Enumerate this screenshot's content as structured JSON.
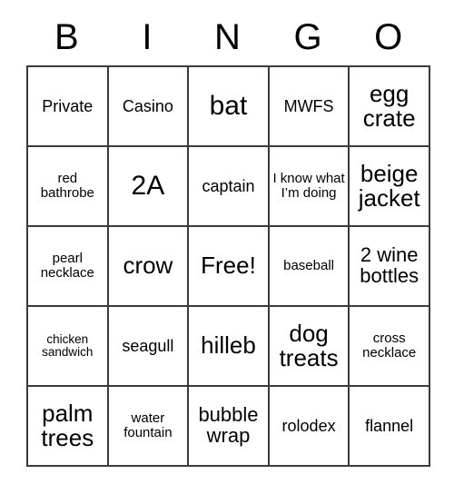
{
  "card": {
    "headers": [
      "B",
      "I",
      "N",
      "G",
      "O"
    ],
    "rows": [
      [
        {
          "text": "Private",
          "size": "fs-md"
        },
        {
          "text": "Casino",
          "size": "fs-md"
        },
        {
          "text": "bat",
          "size": "fs-xxl"
        },
        {
          "text": "MWFS",
          "size": "fs-md"
        },
        {
          "text": "egg crate",
          "size": "fs-xl"
        }
      ],
      [
        {
          "text": "red bathrobe",
          "size": "fs-sm"
        },
        {
          "text": "2A",
          "size": "fs-xxl"
        },
        {
          "text": "captain",
          "size": "fs-md"
        },
        {
          "text": "I know what I’m doing",
          "size": "fs-sm"
        },
        {
          "text": "beige jacket",
          "size": "fs-xl"
        }
      ],
      [
        {
          "text": "pearl necklace",
          "size": "fs-sm"
        },
        {
          "text": "crow",
          "size": "fs-xl"
        },
        {
          "text": "Free!",
          "size": "fs-xl"
        },
        {
          "text": "baseball",
          "size": "fs-sm"
        },
        {
          "text": "2 wine bottles",
          "size": "fs-lg"
        }
      ],
      [
        {
          "text": "chicken sandwich",
          "size": "fs-xs"
        },
        {
          "text": "seagull",
          "size": "fs-md"
        },
        {
          "text": "hilleb",
          "size": "fs-xl"
        },
        {
          "text": "dog treats",
          "size": "fs-xl"
        },
        {
          "text": "cross necklace",
          "size": "fs-sm"
        }
      ],
      [
        {
          "text": "palm trees",
          "size": "fs-xl"
        },
        {
          "text": "water fountain",
          "size": "fs-sm"
        },
        {
          "text": "bubble wrap",
          "size": "fs-lg"
        },
        {
          "text": "rolodex",
          "size": "fs-md"
        },
        {
          "text": "flannel",
          "size": "fs-md"
        }
      ]
    ],
    "free_space_text": "Free!",
    "colors": {
      "background": "#ffffff",
      "text": "#000000",
      "border": "#3a3a3a"
    }
  }
}
